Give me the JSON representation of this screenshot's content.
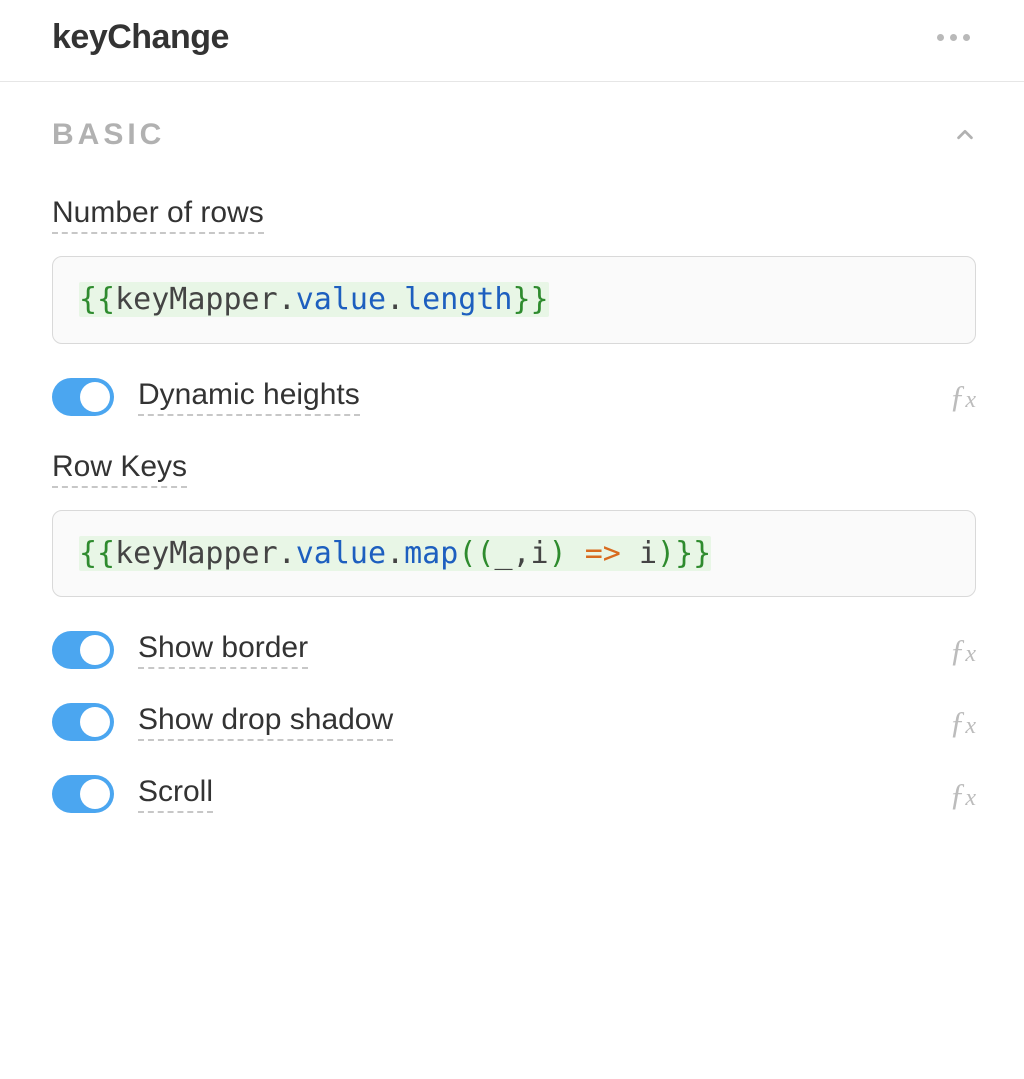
{
  "header": {
    "title": "keyChange"
  },
  "section": {
    "title": "BASIC"
  },
  "fields": {
    "numberOfRows": {
      "label": "Number of rows",
      "expr": {
        "open": "{{",
        "ident": "keyMapper",
        "dot1": ".",
        "prop1": "value",
        "dot2": ".",
        "prop2": "length",
        "close": "}}"
      }
    },
    "rowKeys": {
      "label": "Row Keys",
      "expr": {
        "open": "{{",
        "ident": "keyMapper",
        "dot1": ".",
        "prop1": "value",
        "dot2": ".",
        "method": "map",
        "lparen": "((",
        "args": "_,i",
        "rparen1": ")",
        "arrow": " => ",
        "body": "i",
        "rparen2": ")",
        "close": "}}"
      }
    }
  },
  "toggles": {
    "dynamicHeights": {
      "label": "Dynamic heights",
      "on": true
    },
    "showBorder": {
      "label": "Show border",
      "on": true
    },
    "showDropShadow": {
      "label": "Show drop shadow",
      "on": true
    },
    "scroll": {
      "label": "Scroll",
      "on": true
    }
  },
  "fxLabel": "ƒx"
}
